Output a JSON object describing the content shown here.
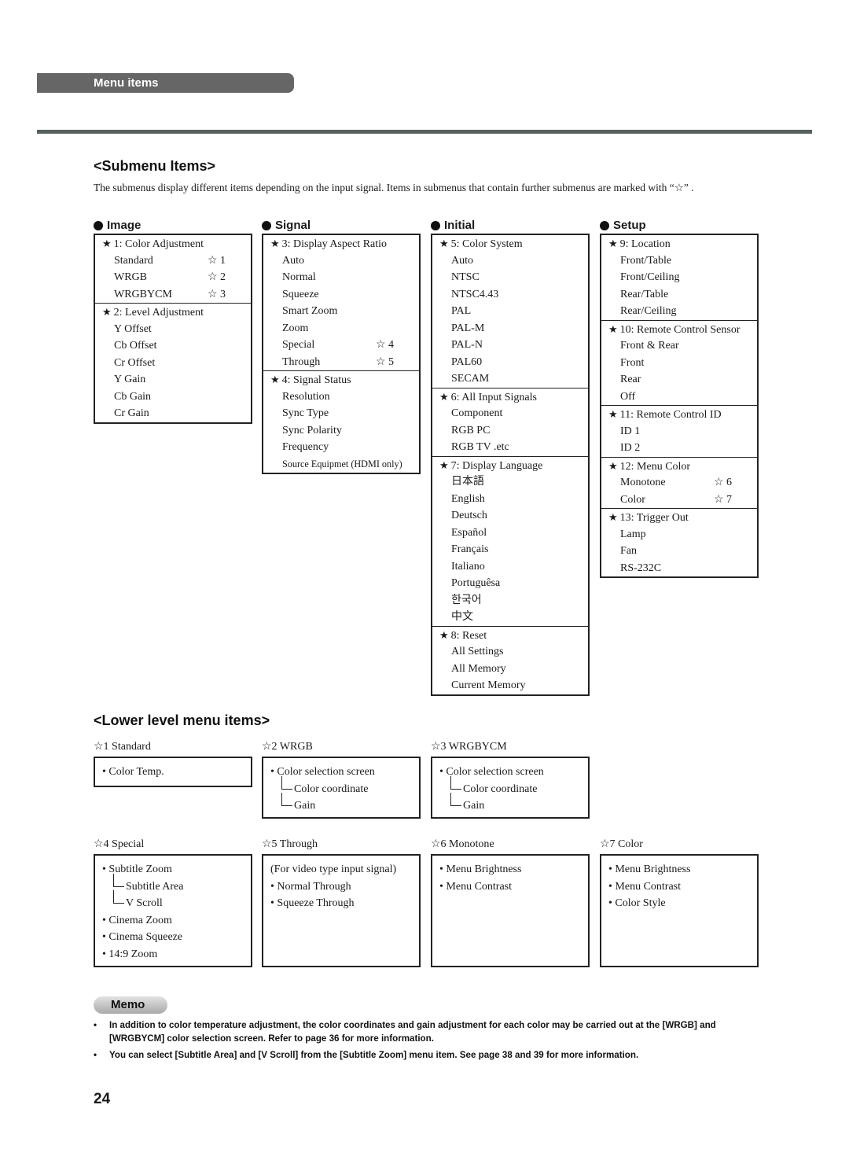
{
  "header": {
    "section_tab": "Menu items"
  },
  "submenu": {
    "title": "<Submenu Items>",
    "intro": "The submenus display different items depending on the input signal. Items in submenus that contain further submenus are marked with “☆” .",
    "columns": [
      {
        "label": "Image",
        "groups": [
          {
            "title": "1: Color Adjustment",
            "items": [
              {
                "text": "Standard",
                "mark": "☆ 1"
              },
              {
                "text": "WRGB",
                "mark": "☆ 2"
              },
              {
                "text": "WRGBYCM",
                "mark": "☆ 3"
              }
            ]
          },
          {
            "title": "2: Level Adjustment",
            "items": [
              {
                "text": "Y Offset"
              },
              {
                "text": "Cb Offset"
              },
              {
                "text": "Cr Offset"
              },
              {
                "text": "Y Gain"
              },
              {
                "text": "Cb Gain"
              },
              {
                "text": "Cr Gain"
              }
            ]
          }
        ]
      },
      {
        "label": "Signal",
        "groups": [
          {
            "title": "3: Display Aspect Ratio",
            "items": [
              {
                "text": "Auto"
              },
              {
                "text": "Normal"
              },
              {
                "text": "Squeeze"
              },
              {
                "text": "Smart Zoom"
              },
              {
                "text": "Zoom"
              },
              {
                "text": "Special",
                "mark": "☆ 4"
              },
              {
                "text": "Through",
                "mark": "☆ 5"
              }
            ]
          },
          {
            "title": "4: Signal Status",
            "items": [
              {
                "text": "Resolution"
              },
              {
                "text": "Sync Type"
              },
              {
                "text": "Sync Polarity"
              },
              {
                "text": "Frequency"
              },
              {
                "text": "Source Equipmet (HDMI only)",
                "small": true
              }
            ]
          }
        ]
      },
      {
        "label": "Initial",
        "groups": [
          {
            "title": "5: Color System",
            "items": [
              {
                "text": "Auto"
              },
              {
                "text": "NTSC"
              },
              {
                "text": "NTSC4.43"
              },
              {
                "text": "PAL"
              },
              {
                "text": "PAL-M"
              },
              {
                "text": "PAL-N"
              },
              {
                "text": "PAL60"
              },
              {
                "text": "SECAM"
              }
            ]
          },
          {
            "title": "6: All Input Signals",
            "items": [
              {
                "text": "Component"
              },
              {
                "text": "RGB PC"
              },
              {
                "text": "RGB TV .etc"
              }
            ]
          },
          {
            "title": "7: Display Language",
            "items": [
              {
                "text": "日本語"
              },
              {
                "text": "English"
              },
              {
                "text": "Deutsch"
              },
              {
                "text": "Español"
              },
              {
                "text": "Français"
              },
              {
                "text": "Italiano"
              },
              {
                "text": "Portuguêsa"
              },
              {
                "text": "한국어"
              },
              {
                "text": "中文"
              }
            ]
          },
          {
            "title": "8: Reset",
            "items": [
              {
                "text": "All Settings"
              },
              {
                "text": "All Memory"
              },
              {
                "text": "Current Memory"
              }
            ]
          }
        ]
      },
      {
        "label": "Setup",
        "groups": [
          {
            "title": "9: Location",
            "items": [
              {
                "text": "Front/Table"
              },
              {
                "text": "Front/Ceiling"
              },
              {
                "text": "Rear/Table"
              },
              {
                "text": "Rear/Ceiling"
              }
            ]
          },
          {
            "title": "10: Remote Control Sensor",
            "items": [
              {
                "text": "Front & Rear"
              },
              {
                "text": "Front"
              },
              {
                "text": "Rear"
              },
              {
                "text": "Off"
              }
            ]
          },
          {
            "title": "11: Remote Control ID",
            "items": [
              {
                "text": "ID 1"
              },
              {
                "text": "ID 2"
              }
            ]
          },
          {
            "title": "12: Menu Color",
            "items": [
              {
                "text": "Monotone",
                "mark": "☆ 6"
              },
              {
                "text": "Color",
                "mark": "☆ 7"
              }
            ]
          },
          {
            "title": "13: Trigger Out",
            "items": [
              {
                "text": "Lamp"
              },
              {
                "text": "Fan"
              },
              {
                "text": "RS-232C"
              }
            ]
          }
        ]
      }
    ]
  },
  "lower": {
    "title": "<Lower level menu items>",
    "boxes": [
      {
        "label": "☆1 Standard",
        "lines": [
          {
            "type": "bullet",
            "text": "Color Temp."
          }
        ]
      },
      {
        "label": "☆2 WRGB",
        "lines": [
          {
            "type": "bullet",
            "text": "Color selection screen"
          },
          {
            "type": "sub",
            "text": "Color coordinate"
          },
          {
            "type": "sub-last",
            "text": "Gain"
          }
        ]
      },
      {
        "label": "☆3 WRGBYCM",
        "lines": [
          {
            "type": "bullet",
            "text": "Color selection screen"
          },
          {
            "type": "sub",
            "text": "Color coordinate"
          },
          {
            "type": "sub-last",
            "text": "Gain"
          }
        ]
      },
      {
        "label": "☆4 Special",
        "lines": [
          {
            "type": "bullet",
            "text": "Subtitle Zoom"
          },
          {
            "type": "sub",
            "text": "Subtitle Area"
          },
          {
            "type": "sub-last",
            "text": "V Scroll"
          },
          {
            "type": "bullet",
            "text": "Cinema Zoom"
          },
          {
            "type": "bullet",
            "text": "Cinema Squeeze"
          },
          {
            "type": "bullet",
            "text": "14:9 Zoom"
          }
        ]
      },
      {
        "label": "☆5 Through",
        "lines": [
          {
            "type": "plain",
            "text": "(For video type input signal)"
          },
          {
            "type": "bullet",
            "text": "Normal Through"
          },
          {
            "type": "bullet",
            "text": "Squeeze Through"
          }
        ]
      },
      {
        "label": "☆6 Monotone",
        "lines": [
          {
            "type": "bullet",
            "text": "Menu Brightness"
          },
          {
            "type": "bullet",
            "text": "Menu Contrast"
          }
        ]
      },
      {
        "label": "☆7 Color",
        "lines": [
          {
            "type": "bullet",
            "text": "Menu Brightness"
          },
          {
            "type": "bullet",
            "text": "Menu Contrast"
          },
          {
            "type": "bullet",
            "text": "Color Style"
          }
        ]
      }
    ]
  },
  "memo": {
    "label": "Memo",
    "items": [
      "In addition to color temperature adjustment, the color coordinates and gain adjustment for each color may be carried out at the [WRGB] and [WRGBYCM] color selection screen. Refer to page 36 for more information.",
      "You can select [Subtitle Area] and [V Scroll] from the [Subtitle Zoom] menu item. See page 38 and 39 for more information."
    ]
  },
  "icons": {
    "filled_star": "★",
    "bullet_dot": "•",
    "memo_bullet": "•"
  },
  "page_number": "24"
}
